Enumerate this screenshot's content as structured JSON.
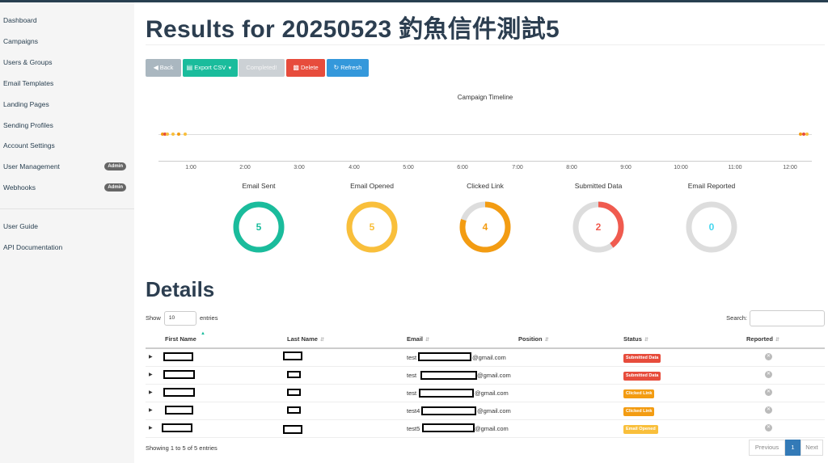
{
  "sidebar": {
    "items": [
      {
        "label": "Dashboard"
      },
      {
        "label": "Campaigns"
      },
      {
        "label": "Users & Groups"
      },
      {
        "label": "Email Templates"
      },
      {
        "label": "Landing Pages"
      },
      {
        "label": "Sending Profiles"
      },
      {
        "label": "Account Settings"
      },
      {
        "label": "User Management",
        "badge": "Admin"
      },
      {
        "label": "Webhooks",
        "badge": "Admin"
      }
    ],
    "secondary": [
      {
        "label": "User Guide"
      },
      {
        "label": "API Documentation"
      }
    ]
  },
  "page": {
    "title": "Results for 20250523 釣魚信件測試5"
  },
  "toolbar": {
    "back": "Back",
    "export": "Export CSV",
    "completed": "Completed!",
    "delete": "Delete",
    "refresh": "Refresh"
  },
  "timeline": {
    "title": "Campaign Timeline",
    "ticks": [
      "1:00",
      "2:00",
      "3:00",
      "4:00",
      "5:00",
      "6:00",
      "7:00",
      "8:00",
      "9:00",
      "10:00",
      "11:00",
      "12:00"
    ]
  },
  "stats": [
    {
      "label": "Email Sent",
      "value": "5",
      "fraction": 1.0,
      "color": "#1abc9c"
    },
    {
      "label": "Email Opened",
      "value": "5",
      "fraction": 1.0,
      "color": "#f9bf3b"
    },
    {
      "label": "Clicked Link",
      "value": "4",
      "fraction": 0.8,
      "color": "#f39c12"
    },
    {
      "label": "Submitted Data",
      "value": "2",
      "fraction": 0.4,
      "color": "#f05b4f"
    },
    {
      "label": "Email Reported",
      "value": "0",
      "fraction": 0.0,
      "color": "#45d6ef"
    }
  ],
  "details": {
    "title": "Details",
    "show_prefix": "Show",
    "show_value": "10",
    "show_suffix": "entries",
    "search_label": "Search:",
    "columns": [
      "First Name",
      "Last Name",
      "Email",
      "Position",
      "Status",
      "Reported"
    ],
    "rows": [
      {
        "email_prefix": "test",
        "email_suffix": "@gmail.com",
        "status": "Submitted Data",
        "status_color": "#e74c3c"
      },
      {
        "email_prefix": "test",
        "email_suffix": "@gmail.com",
        "status": "Submitted Data",
        "status_color": "#e74c3c"
      },
      {
        "email_prefix": "test",
        "email_suffix": "@gmail.com",
        "status": "Clicked Link",
        "status_color": "#f39c12"
      },
      {
        "email_prefix": "test4",
        "email_suffix": "@gmail.com",
        "status": "Clicked Link",
        "status_color": "#f39c12"
      },
      {
        "email_prefix": "test5",
        "email_suffix": "@gmail.com",
        "status": "Email Opened",
        "status_color": "#f9bf3b"
      }
    ],
    "showing_text": "Showing 1 to 5 of 5 entries",
    "pager_prev": "Previous",
    "pager_page": "1",
    "pager_next": "Next"
  },
  "icons": {
    "back": "back-circle-icon",
    "export": "file-export-icon",
    "dropdown": "caret-down-icon",
    "delete": "trash-icon",
    "refresh": "refresh-icon",
    "expand": "caret-right-icon",
    "reported": "times-circle-icon",
    "sort": "sort-icon"
  }
}
